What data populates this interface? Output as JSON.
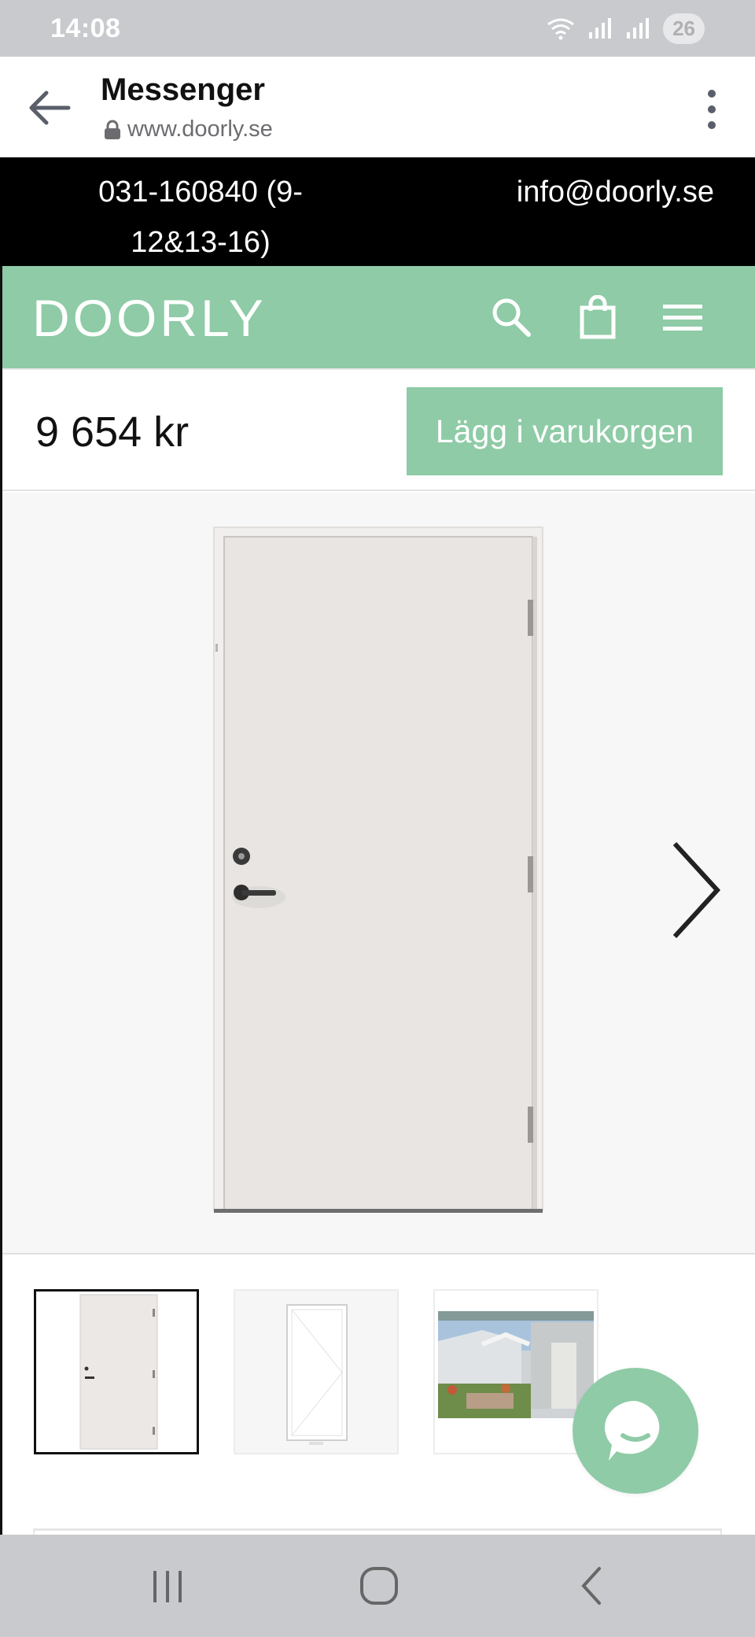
{
  "status_bar": {
    "time": "14:08",
    "battery": "26"
  },
  "browser": {
    "title": "Messenger",
    "url": "www.doorly.se"
  },
  "contact": {
    "phone": "031-160840 (9-12&13-16)",
    "email": "info@doorly.se"
  },
  "header": {
    "logo": "DOORLY"
  },
  "product": {
    "price": "9 654 kr",
    "add_to_cart_label": "Lägg i varukorgen"
  },
  "colors": {
    "brand_green": "#8ecba6",
    "contact_bar": "#000000",
    "system_bar": "#c9cacd"
  },
  "icons": {
    "back": "arrow-left-icon",
    "lock": "lock-icon",
    "more": "more-vertical-icon",
    "search": "search-icon",
    "cart": "shopping-bag-icon",
    "menu": "hamburger-menu-icon",
    "next": "chevron-right-icon",
    "chat": "chat-bubble-icon",
    "nav_recents": "recents-icon",
    "nav_home": "home-icon",
    "nav_back": "back-icon"
  }
}
